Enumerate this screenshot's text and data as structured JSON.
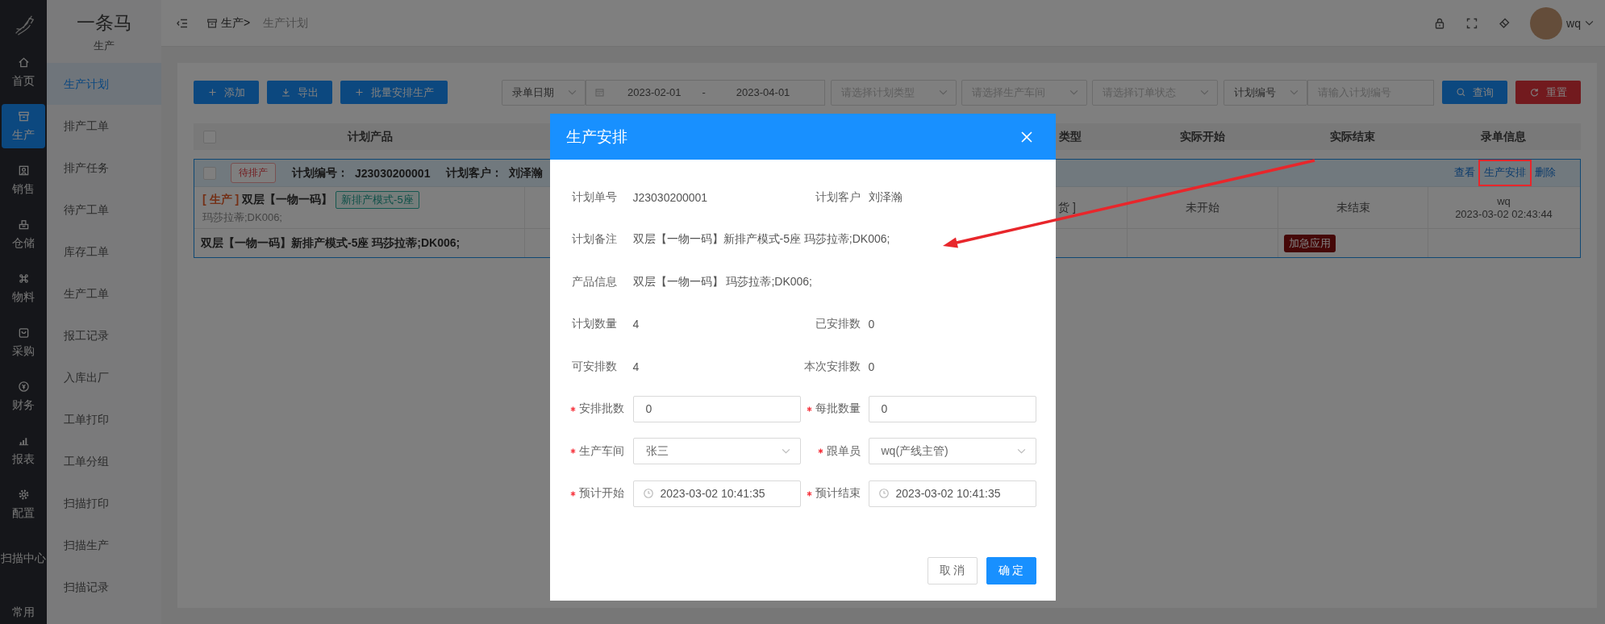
{
  "rail": {
    "items": [
      {
        "label": "首页",
        "kind": "home",
        "selected": false
      },
      {
        "label": "生产",
        "kind": "archive",
        "selected": true
      },
      {
        "label": "销售",
        "kind": "portrait",
        "selected": false
      },
      {
        "label": "仓储",
        "kind": "stack",
        "selected": false
      },
      {
        "label": "物料",
        "kind": "command",
        "selected": false
      },
      {
        "label": "采购",
        "kind": "bag",
        "selected": false
      },
      {
        "label": "财务",
        "kind": "coin",
        "selected": false
      },
      {
        "label": "报表",
        "kind": "bars",
        "selected": false
      },
      {
        "label": "配置",
        "kind": "gear",
        "selected": false
      },
      {
        "label": "扫描中心",
        "kind": "text",
        "selected": false
      },
      {
        "label": "常用",
        "kind": "text",
        "selected": false
      }
    ]
  },
  "app": {
    "title": "一条马",
    "module": "生产"
  },
  "menu": {
    "items": [
      {
        "label": "生产计划",
        "selected": true
      },
      {
        "label": "排产工单",
        "selected": false
      },
      {
        "label": "排产任务",
        "selected": false
      },
      {
        "label": "待产工单",
        "selected": false
      },
      {
        "label": "库存工单",
        "selected": false
      },
      {
        "label": "生产工单",
        "selected": false
      },
      {
        "label": "报工记录",
        "selected": false
      },
      {
        "label": "入库出厂",
        "selected": false
      },
      {
        "label": "工单打印",
        "selected": false
      },
      {
        "label": "工单分组",
        "selected": false
      },
      {
        "label": "扫描打印",
        "selected": false
      },
      {
        "label": "扫描生产",
        "selected": false
      },
      {
        "label": "扫描记录",
        "selected": false
      }
    ]
  },
  "header": {
    "breadcrumb": [
      {
        "label": "生产>"
      },
      {
        "label": "生产计划"
      }
    ],
    "user": {
      "name": "wq"
    }
  },
  "toolbar": {
    "buttons": [
      {
        "label": "添加",
        "kind": "add"
      },
      {
        "label": "导出",
        "kind": "export"
      },
      {
        "label": "批量安排生产",
        "kind": "add"
      }
    ],
    "date_type": {
      "value": "录单日期"
    },
    "date_range": {
      "start": "2023-02-01",
      "separator": "-",
      "end": "2023-04-01"
    },
    "selects": [
      {
        "placeholder": "请选择计划类型"
      },
      {
        "placeholder": "请选择生产车间"
      },
      {
        "placeholder": "请选择订单状态"
      }
    ],
    "code_type": {
      "value": "计划编号"
    },
    "code_input": {
      "placeholder": "请输入计划编号"
    },
    "actions": [
      {
        "label": "查询",
        "kind": "search"
      },
      {
        "label": "重置",
        "kind": "reset"
      }
    ]
  },
  "table": {
    "header_checked": false,
    "columns": [
      "计划产品",
      "类型",
      "实际开始",
      "实际结束",
      "录单信息"
    ],
    "group": {
      "checked": false,
      "status": "待排产",
      "plan_no_label": "计划编号：",
      "plan_no": "J23030200001",
      "customer_label": "计划客户：",
      "customer": "刘泽瀚",
      "actions": [
        {
          "label": "查看",
          "highlighted": false
        },
        {
          "label": "生产安排",
          "highlighted": true
        },
        {
          "label": "删除",
          "highlighted": false
        }
      ]
    },
    "product_row": {
      "tag": "[ 生产 ]",
      "name": "双层【一物一码】",
      "mode": "新排产模式-5座",
      "spec": "玛莎拉蒂;DK006;",
      "type": "货 ]",
      "start": "未开始",
      "end": "未结束",
      "creator": "wq",
      "created": "2023-03-02 02:43:44"
    },
    "note_row": {
      "note": "双层【一物一码】新排产模式-5座 玛莎拉蒂;DK006;",
      "badge": "加急应用"
    }
  },
  "modal": {
    "title": "生产安排",
    "info_rows": [
      {
        "cells": [
          {
            "label": "计划单号",
            "value": "J23030200001"
          },
          {
            "label": "计划客户",
            "value": "刘泽瀚"
          }
        ]
      },
      {
        "cells": [
          {
            "label": "计划备注",
            "value": "双层【一物一码】新排产模式-5座 玛莎拉蒂;DK006;"
          }
        ]
      },
      {
        "cells": [
          {
            "label": "产品信息",
            "value": "双层【一物一码】 玛莎拉蒂;DK006;"
          }
        ]
      },
      {
        "cells": [
          {
            "label": "计划数量",
            "value": "4"
          },
          {
            "label": "已安排数",
            "value": "0"
          }
        ]
      },
      {
        "cells": [
          {
            "label": "可安排数",
            "value": "4"
          },
          {
            "label": "本次安排数",
            "value": "0"
          }
        ]
      }
    ],
    "field_rows": [
      {
        "cells": [
          {
            "label": "安排批数",
            "required": true,
            "kind": "input",
            "value": "0"
          },
          {
            "label": "每批数量",
            "required": true,
            "kind": "input",
            "value": "0"
          }
        ]
      },
      {
        "cells": [
          {
            "label": "生产车间",
            "required": true,
            "kind": "select",
            "value": "张三"
          },
          {
            "label": "跟单员",
            "required": true,
            "kind": "select",
            "value": "wq(产线主管)"
          }
        ]
      },
      {
        "cells": [
          {
            "label": "预计开始",
            "required": true,
            "kind": "datetime",
            "value": "2023-03-02 10:41:35"
          },
          {
            "label": "预计结束",
            "required": true,
            "kind": "datetime",
            "value": "2023-03-02 10:41:35"
          }
        ]
      }
    ],
    "buttons": [
      {
        "label": "取 消",
        "kind": "default"
      },
      {
        "label": "确 定",
        "kind": "primary"
      }
    ]
  }
}
